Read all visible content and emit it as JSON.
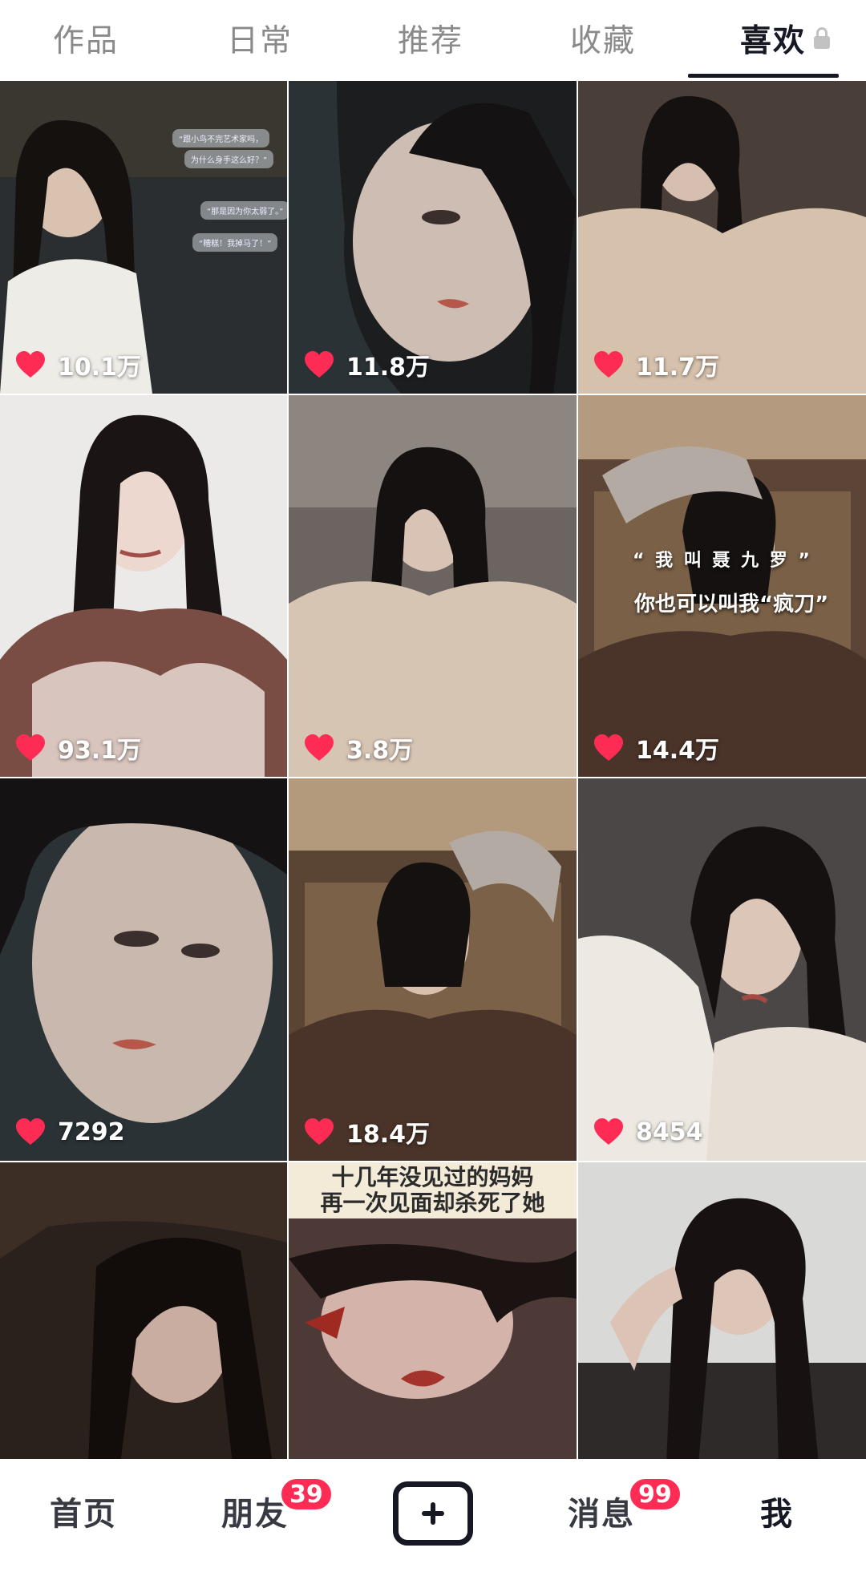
{
  "tabs": {
    "items": [
      {
        "label": "作品"
      },
      {
        "label": "日常"
      },
      {
        "label": "推荐"
      },
      {
        "label": "收藏"
      },
      {
        "label": "喜欢",
        "active": true,
        "locked": true
      }
    ]
  },
  "grid": {
    "items": [
      {
        "likes": "10.1万",
        "overlay": {
          "bubbles": [
            "“跟小鸟不完艺术家吗，",
            "为什么身手这么好？”",
            "“那是因为你太弱了。”",
            "“糟糕！我掉马了！”"
          ]
        }
      },
      {
        "likes": "11.8万"
      },
      {
        "likes": "11.7万"
      },
      {
        "likes": "93.1万"
      },
      {
        "likes": "3.8万"
      },
      {
        "likes": "14.4万",
        "overlay": {
          "line1": "“ 我 叫 聂 九 罗 ”",
          "line2": "你也可以叫我“疯刀”"
        }
      },
      {
        "likes": "7292"
      },
      {
        "likes": "18.4万"
      },
      {
        "likes": "8454"
      },
      {
        "likes": null
      },
      {
        "likes": null,
        "overlay": {
          "banner": [
            "十几年没见过的妈妈",
            "再一次见面却杀死了她"
          ]
        }
      },
      {
        "likes": null
      }
    ]
  },
  "bottom_nav": {
    "home": "首页",
    "friends": "朋友",
    "friends_badge": "39",
    "messages": "消息",
    "messages_badge": "99",
    "me": "我"
  },
  "colors": {
    "accent": "#fe2c55",
    "text_primary": "#161823",
    "text_inactive": "#8a8a8a"
  }
}
